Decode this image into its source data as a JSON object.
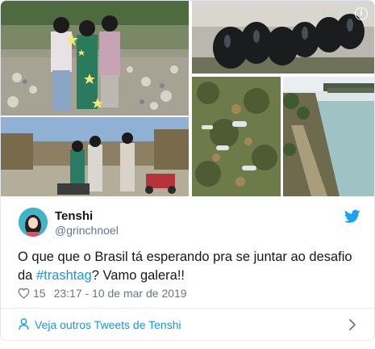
{
  "tweet": {
    "author_name": "Tenshi",
    "author_handle": "@grinchnoel",
    "text_before": "O que que o Brasil tá esperando pra se juntar ao desafio da ",
    "hashtag": "#trashtag",
    "text_after": "? Vamo galera!!",
    "like_count": "15",
    "timestamp": "23:17 - 10 de mar de 2019"
  },
  "footer": {
    "link_label": "Veja outros Tweets de Tenshi"
  },
  "icons": {
    "info": "info-icon",
    "bird": "twitter-bird-icon",
    "heart": "heart-icon",
    "person": "person-icon",
    "chevron": "chevron-right-icon"
  },
  "colors": {
    "link": "#1b95e0",
    "text": "#14171a",
    "muted": "#657786",
    "border": "#e1e8ed"
  }
}
